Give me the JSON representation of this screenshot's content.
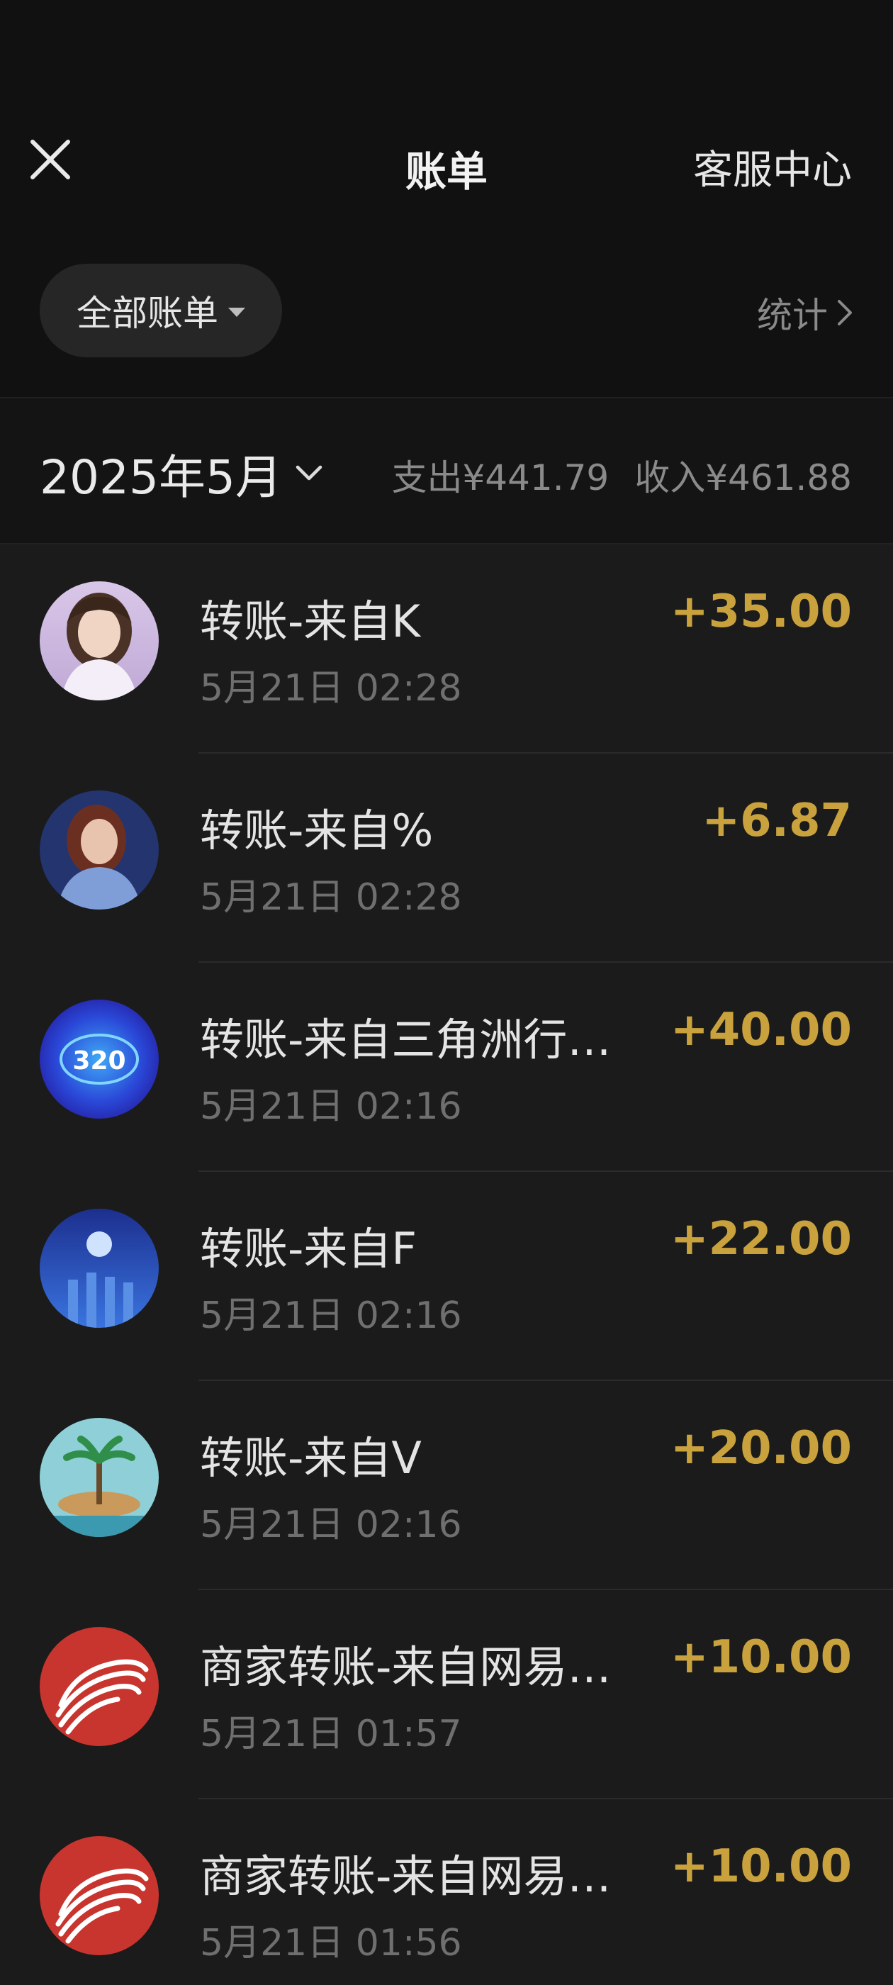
{
  "header": {
    "title": "账单",
    "service_label": "客服中心",
    "filter_label": "全部账单",
    "stats_label": "统计"
  },
  "month_bar": {
    "month_label": "2025年5月",
    "expense_label": "支出¥441.79",
    "income_label": "收入¥461.88"
  },
  "colors": {
    "background": "#111111",
    "list_background": "#1b1b1b",
    "income_amount": "#c9a23d",
    "secondary_text": "#6f6f6f"
  },
  "transactions": [
    {
      "title": "转账-来自K",
      "time": "5月21日 02:28",
      "amount": "+35.00",
      "avatar": "portrait-woman-avatar"
    },
    {
      "title": "转账-来自%",
      "time": "5月21日 02:28",
      "amount": "+6.87",
      "avatar": "portrait-woman-blue-avatar"
    },
    {
      "title": "转账-来自三角洲行…",
      "time": "5月21日 02:16",
      "amount": "+40.00",
      "avatar": "blue-gauge-avatar",
      "avatar_text": "320"
    },
    {
      "title": "转账-来自F",
      "time": "5月21日 02:16",
      "amount": "+22.00",
      "avatar": "night-moon-avatar"
    },
    {
      "title": "转账-来自V",
      "time": "5月21日 02:16",
      "amount": "+20.00",
      "avatar": "palm-island-avatar"
    },
    {
      "title": "商家转账-来自网易…",
      "time": "5月21日 01:57",
      "amount": "+10.00",
      "avatar": "netease-logo-avatar"
    },
    {
      "title": "商家转账-来自网易…",
      "time": "5月21日 01:56",
      "amount": "+10.00",
      "avatar": "netease-logo-avatar"
    }
  ]
}
